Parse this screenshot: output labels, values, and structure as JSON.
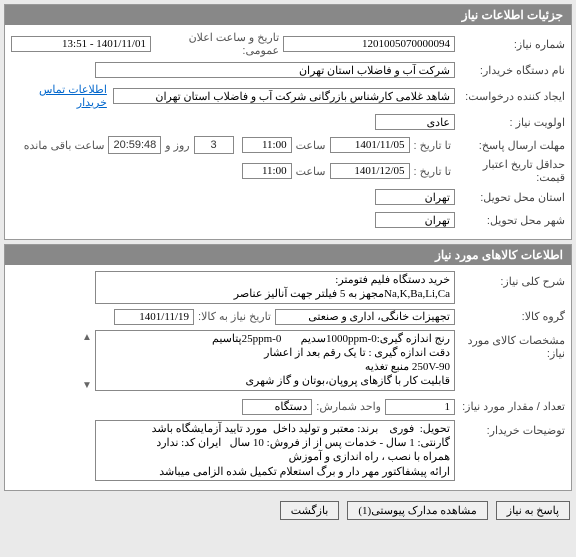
{
  "panel1": {
    "title": "جزئیات اطلاعات نیاز",
    "need_number_label": "شماره نیاز:",
    "need_number": "1201005070000094",
    "announce_dt_label": "تاریخ و ساعت اعلان عمومی:",
    "announce_dt": "1401/11/01 - 13:51",
    "buyer_name_label": "نام دستگاه خریدار:",
    "buyer_name": "شرکت آب و فاضلاب استان تهران",
    "creator_label": "ایجاد کننده درخواست:",
    "creator": "شاهد غلامی کارشناس بازرگانی شرکت آب و فاضلاب استان تهران",
    "buyer_contact_link": "اطلاعات تماس خریدار",
    "priority_label": "اولویت نیاز :",
    "priority": "عادی",
    "deadline_label": "مهلت ارسال پاسخ:",
    "to_date_label": "تا تاریخ :",
    "deadline_date": "1401/11/05",
    "time_label": "ساعت",
    "deadline_time": "11:00",
    "days_remain": "3",
    "days_remain_label": "روز و",
    "time_remain": "20:59:48",
    "time_remain_label": "ساعت باقی مانده",
    "valid_min_label": "حداقل تاریخ اعتبار قیمت:",
    "valid_date": "1401/12/05",
    "valid_time": "11:00",
    "delivery_place_label": "استان محل تحویل:",
    "delivery_place": "تهران",
    "delivery_city_label": "شهر محل تحویل:",
    "delivery_city": "تهران"
  },
  "panel2": {
    "title": "اطلاعات کالاهای مورد نیاز",
    "desc_label": "شرح کلی نیاز:",
    "desc": "خرید دستگاه فلیم فتومتر:\nNa,K,Ba,Li,Caمجهز به 5 فیلتر جهت آنالیز عناصر",
    "group_label": "گروه کالا:",
    "group": "تجهیزات خانگی، اداری و صنعتی",
    "need_date_label": "تاریخ نیاز به کالا:",
    "need_date": "1401/11/19",
    "spec_label": "مشخصات کالای مورد نیاز:",
    "spec": "رنج اندازه گیری:1000ppm-0سدیم       25ppm-0پتاسیم\nدقت اندازه گیری : تا یک رقم بعد از اعشار\n250V-90 منبع تغذیه\nقابلیت کار با گازهای پروپان،بوتان و گاز شهری",
    "qty_label": "تعداد / مقدار مورد نیاز:",
    "qty": "1",
    "unit_label": "واحد شمارش:",
    "unit": "دستگاه",
    "buyer_notes_label": "توضیحات خریدار:",
    "buyer_notes": "تحویل:  فوری    برند: معتبر و تولید داخل  مورد تایید آزمایشگاه باشد\nگارنتی: 1 سال - خدمات پس از از فروش: 10 سال   ایران کد: ندارد\nهمراه با نصب ، راه اندازی و آموزش\nارائه پیشفاکتور مهر دار و برگ استعلام تکمیل شده الزامی میباشد"
  },
  "footer": {
    "reply": "پاسخ به نیاز",
    "attach": "مشاهده مدارک پیوستی(1)",
    "back": "بازگشت"
  }
}
